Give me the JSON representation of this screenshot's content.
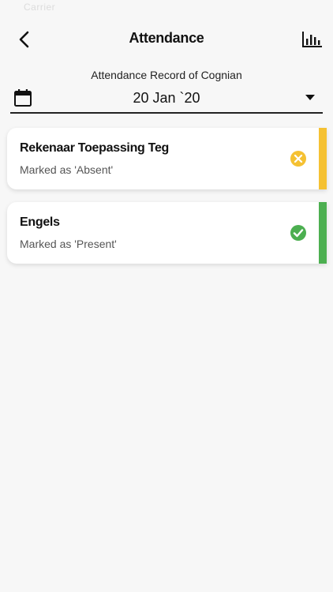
{
  "status_bar": {
    "carrier": "Carrier"
  },
  "header": {
    "title": "Attendance",
    "back_icon": "chevron-left-icon",
    "chart_icon": "bar-chart-icon"
  },
  "subtitle": "Attendance Record of Cognian",
  "date_picker": {
    "value": "20 Jan `20",
    "calendar_icon": "calendar-icon",
    "dropdown_icon": "caret-down-icon"
  },
  "records": [
    {
      "subject": "Rekenaar Toepassing Teg",
      "status": "Marked as 'Absent'",
      "icon": "cancel-circle-icon",
      "color": "#f5c132"
    },
    {
      "subject": "Engels",
      "status": "Marked as 'Present'",
      "icon": "check-circle-icon",
      "color": "#4caf50"
    }
  ]
}
